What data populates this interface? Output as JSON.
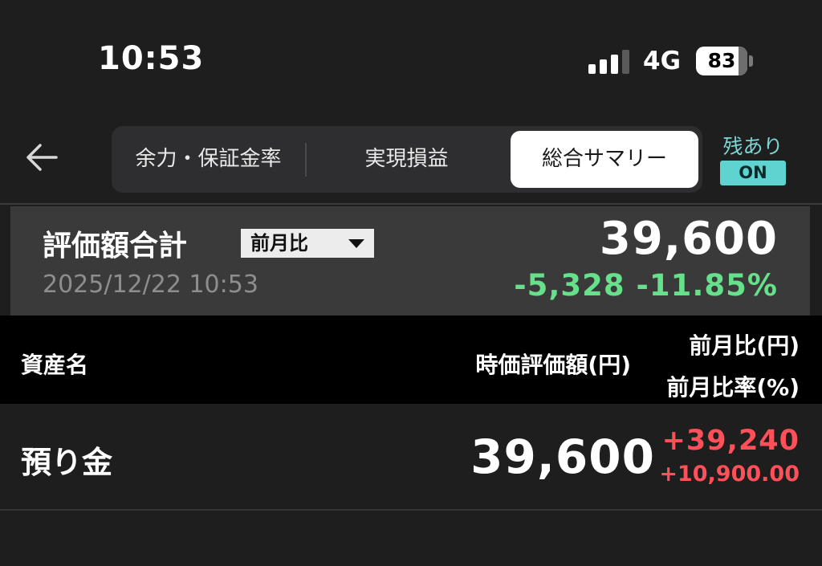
{
  "status_bar": {
    "time": "10:53",
    "network": "4G",
    "battery_level": "83",
    "battery_fraction": 0.83,
    "signal_bars_active": 3,
    "signal_bars_total": 4
  },
  "nav": {
    "back_icon": "arrow-left-icon",
    "tabs": [
      {
        "label": "余力・保証金率",
        "active": false
      },
      {
        "label": "実現損益",
        "active": false
      },
      {
        "label": "総合サマリー",
        "active": true
      }
    ],
    "remain_label": "残あり",
    "remain_status": "ON"
  },
  "summary": {
    "title": "評価額合計",
    "period_selected": "前月比",
    "date": "2025/12/22 10:53",
    "total": "39,600",
    "change": "-5,328 -11.85%"
  },
  "table": {
    "headers": {
      "asset": "資産名",
      "value": "時価評価額(円)",
      "diff": "前月比(円)",
      "rate": "前月比率(%)"
    },
    "rows": [
      {
        "name": "預り金",
        "value": "39,600",
        "diff": "+39,240",
        "rate": "+10,900.00"
      }
    ]
  },
  "colors": {
    "background": "#1e1e1e",
    "positive": "#66e08a",
    "negative": "#ff4f58",
    "accent": "#5fd3d0"
  }
}
